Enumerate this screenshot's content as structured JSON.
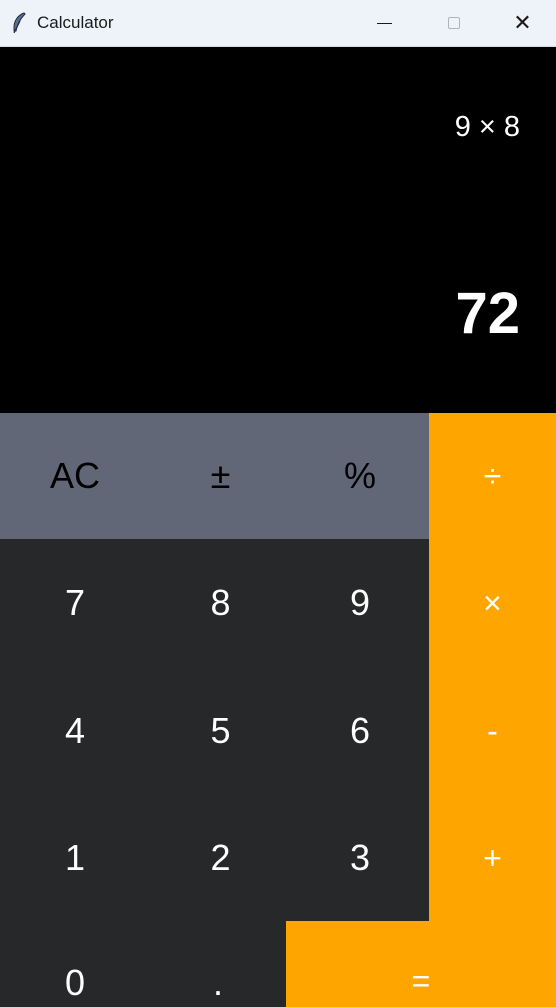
{
  "window": {
    "title": "Calculator",
    "app_icon": "feather-icon",
    "controls": {
      "minimize": "minimize-icon",
      "maximize": "maximize-icon",
      "close": "close-icon",
      "close_glyph": "✕"
    }
  },
  "display": {
    "expression": "9 × 8",
    "result": "72"
  },
  "keys": {
    "ac": "AC",
    "plus_minus": "±",
    "percent": "%",
    "divide": "÷",
    "seven": "7",
    "eight": "8",
    "nine": "9",
    "multiply": "×",
    "four": "4",
    "five": "5",
    "six": "6",
    "minus": "-",
    "one": "1",
    "two": "2",
    "three": "3",
    "plus": "+",
    "zero": "0",
    "decimal": ".",
    "equals": "="
  },
  "colors": {
    "function_key": "#616777",
    "number_key": "#272829",
    "operator_key": "#ffa500",
    "display_bg": "#000000",
    "titlebar_bg": "#eef2f9"
  }
}
